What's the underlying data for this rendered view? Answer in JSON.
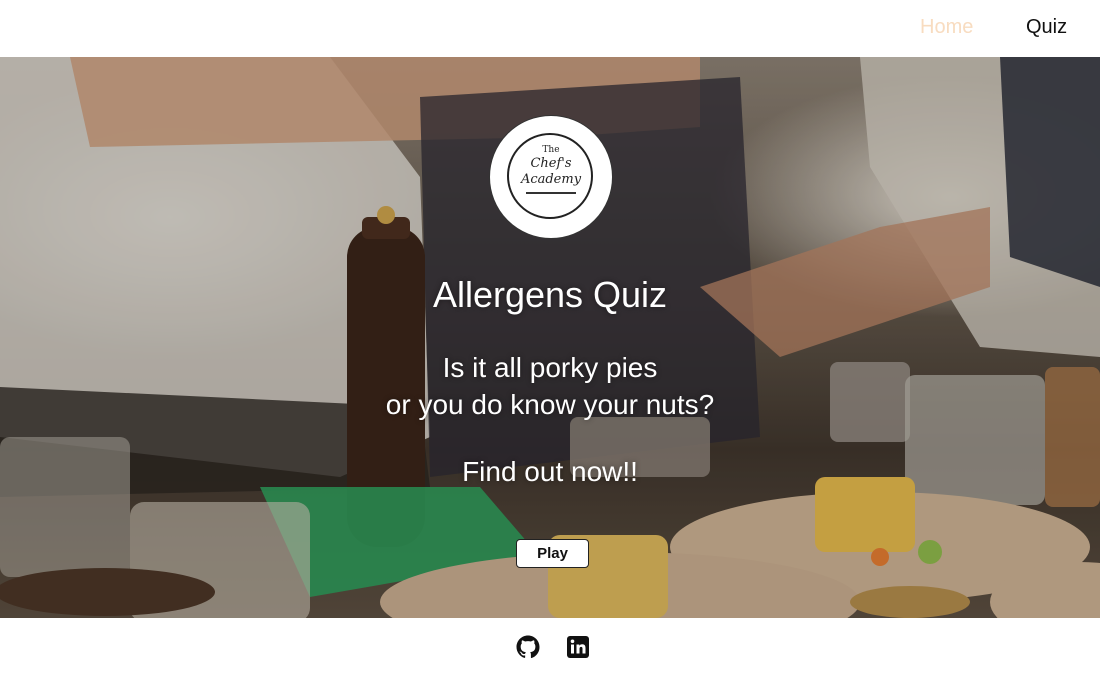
{
  "nav": {
    "home_label": "Home",
    "quiz_label": "Quiz",
    "active_color": "#f8dcc0"
  },
  "logo": {
    "line1": "The",
    "line2": "Chef's",
    "line3": "Academy"
  },
  "hero": {
    "title": "Allergens Quiz",
    "subtitle_line1": "Is it all porky pies",
    "subtitle_line2": "or you do know your nuts?",
    "cta_text": "Find out now!!",
    "play_label": "Play",
    "background_image": "chefs-seasoning-dishes-in-kitchen"
  },
  "footer": {
    "icons": [
      "github-icon",
      "linkedin-icon"
    ]
  }
}
